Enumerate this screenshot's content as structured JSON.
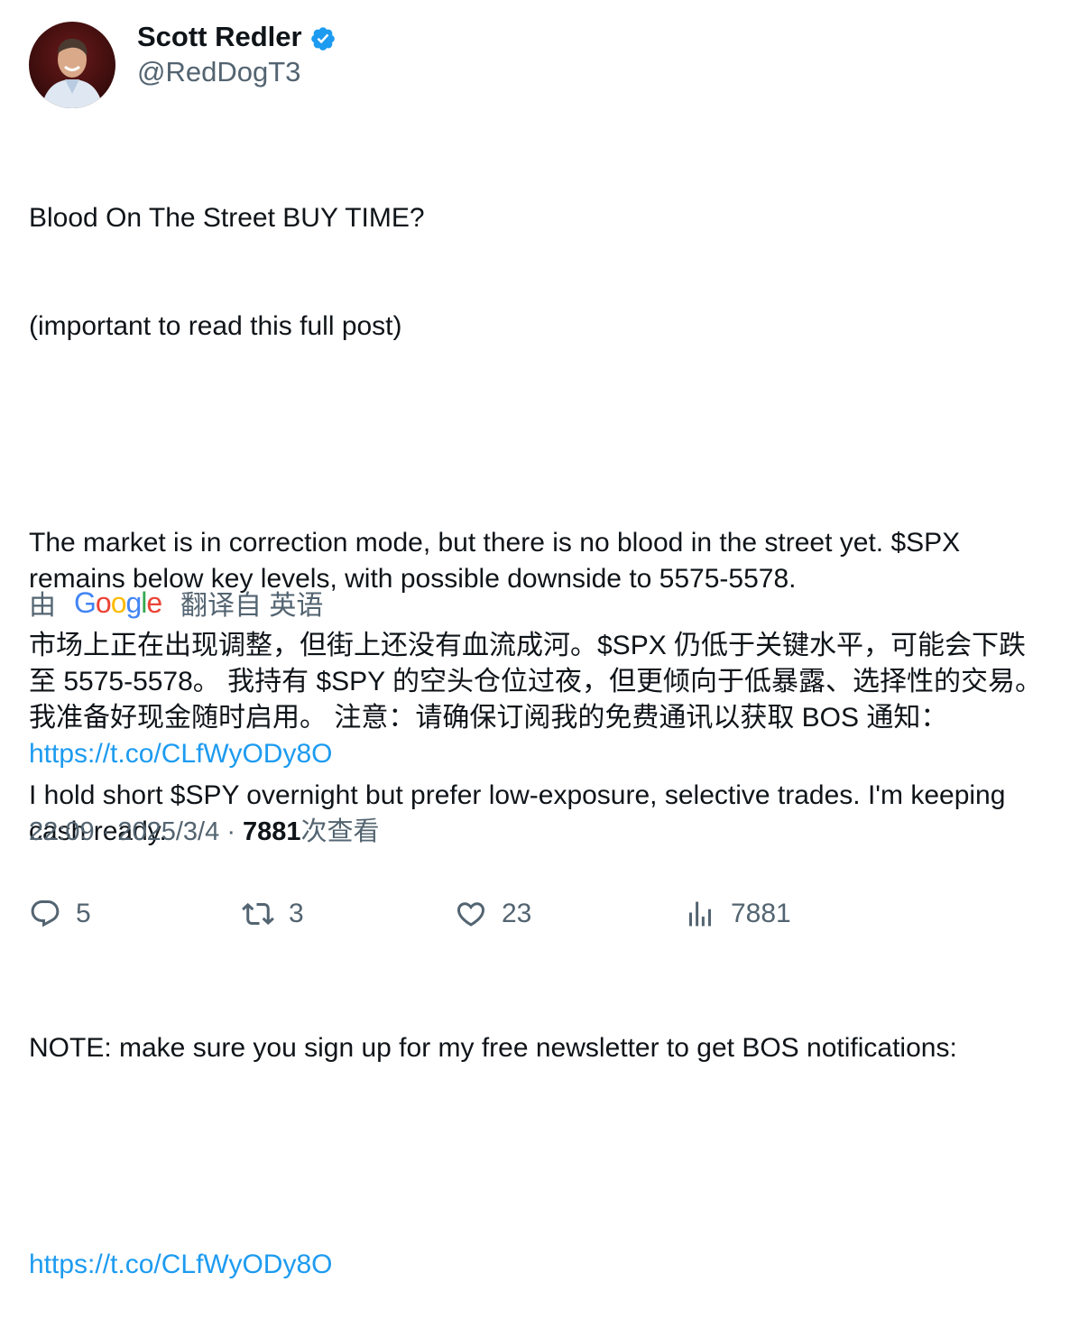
{
  "author": {
    "display_name": "Scott Redler",
    "handle": "@RedDogT3",
    "verified": true
  },
  "tweet": {
    "lines": [
      "Blood On The Street BUY TIME?",
      "(important to read this full post)",
      "",
      "The market is in correction mode, but there is no blood in the street yet. $SPX remains below key levels, with possible downside to 5575-5578.",
      "",
      "I hold short $SPY overnight but prefer low-exposure, selective trades. I'm keeping cash ready.",
      "",
      "NOTE: make sure you sign up for my free newsletter to get BOS notifications:",
      ""
    ],
    "link": "https://t.co/CLfWyODy8O"
  },
  "translation": {
    "by_label": "由",
    "provider": "Google",
    "from_label": "翻译自 英语",
    "text": "市场上正在出现调整，但街上还没有血流成河。$SPX 仍低于关键水平，可能会下跌至 5575-5578。 我持有 $SPY 的空头仓位过夜，但更倾向于低暴露、选择性的交易。我准备好现金随时启用。 注意：请确保订阅我的免费通讯以获取 BOS 通知： ",
    "link": "https://t.co/CLfWyODy8O"
  },
  "meta": {
    "time": "22:09",
    "date": "2025/3/4",
    "views_count": "7881",
    "views_label": "次查看"
  },
  "actions": {
    "replies": "5",
    "retweets": "3",
    "likes": "23",
    "views": "7881"
  },
  "colors": {
    "link": "#1d9bf0",
    "secondary_text": "#536471",
    "verified_badge": "#1d9bf0"
  }
}
